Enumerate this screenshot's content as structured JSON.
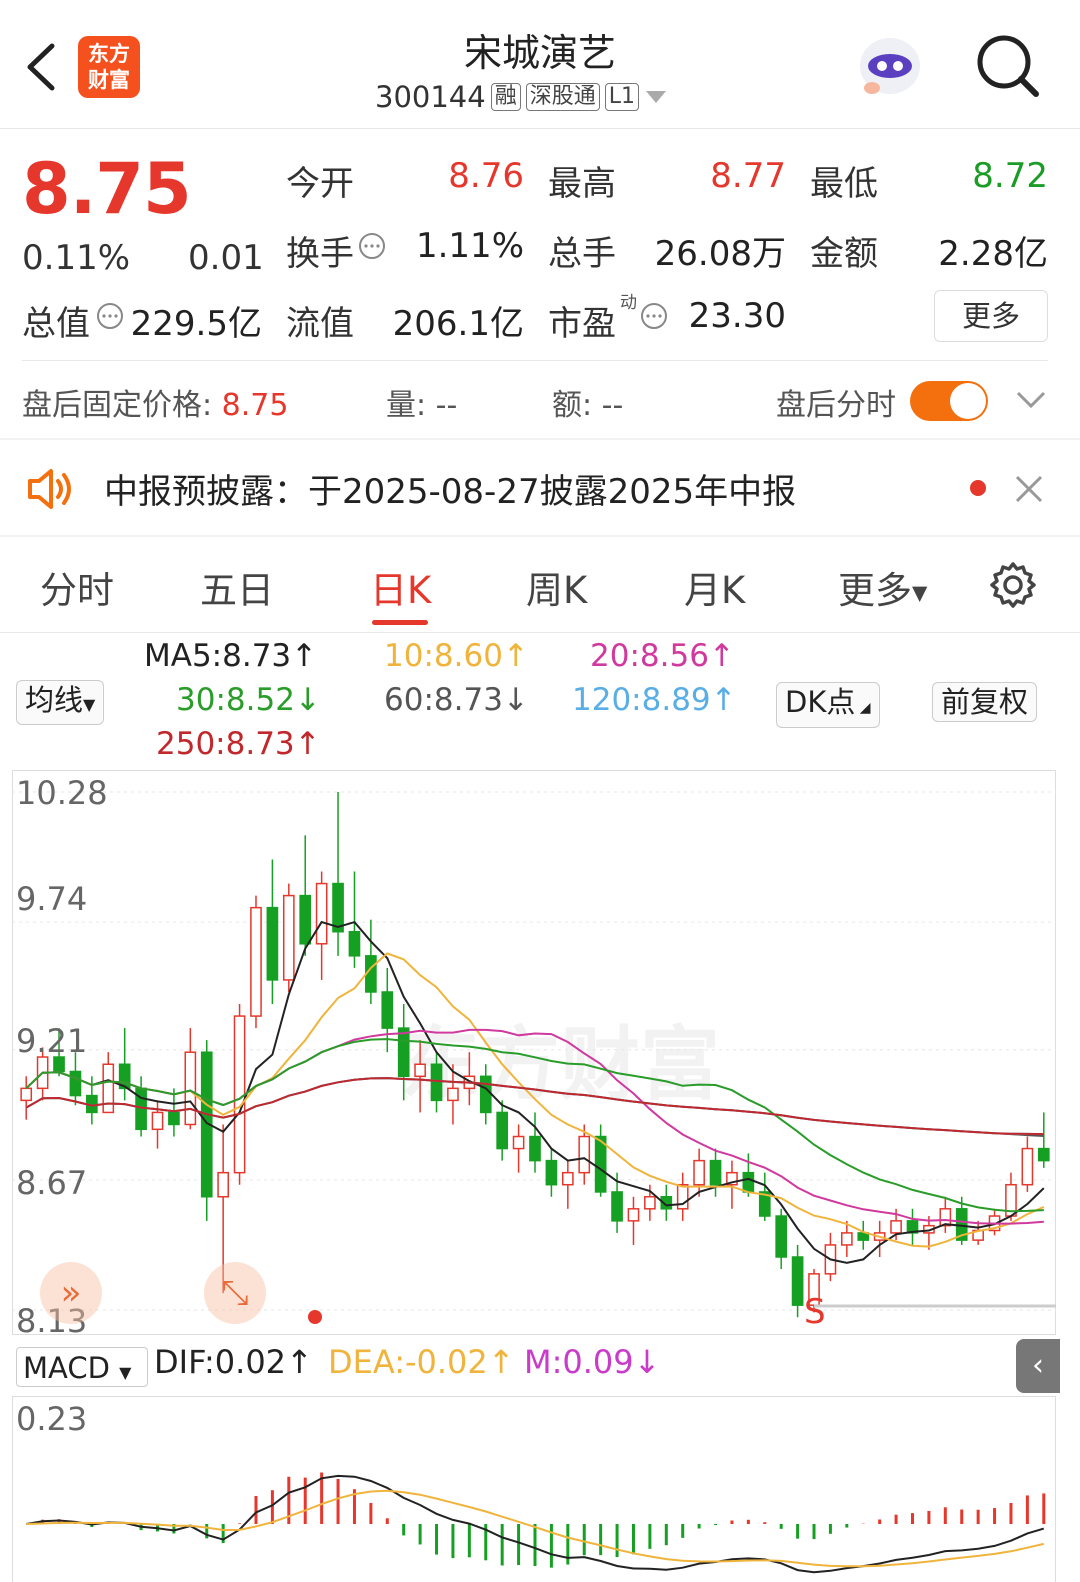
{
  "header": {
    "app_logo_text_line1": "东方",
    "app_logo_text_line2": "财富",
    "stock_name": "宋城演艺",
    "stock_code": "300144",
    "tags": [
      "融",
      "深股通",
      "L1"
    ]
  },
  "quote": {
    "price": "8.75",
    "change_pct": "0.11%",
    "change": "0.01",
    "fields": [
      {
        "label": "今开",
        "value": "8.76",
        "color": "red"
      },
      {
        "label": "最高",
        "value": "8.77",
        "color": "red"
      },
      {
        "label": "最低",
        "value": "8.72",
        "color": "green"
      },
      {
        "label": "换手",
        "value": "1.11%",
        "color": "normal"
      },
      {
        "label": "总手",
        "value": "26.08万",
        "color": "normal"
      },
      {
        "label": "金额",
        "value": "2.28亿",
        "color": "normal"
      },
      {
        "label": "总值",
        "value": "229.5亿",
        "color": "normal"
      },
      {
        "label": "流值",
        "value": "206.1亿",
        "color": "normal"
      },
      {
        "label": "市盈",
        "value": "23.30",
        "color": "normal",
        "superscript": "动"
      }
    ],
    "more_label": "更多"
  },
  "after_hours": {
    "fixed_price_label": "盘后固定价格:",
    "fixed_price_value": "8.75",
    "volume_label": "量:",
    "volume_value": "--",
    "amount_label": "额:",
    "amount_value": "--",
    "intraday_label": "盘后分时",
    "intraday_on": true
  },
  "notice": {
    "text": "中报预披露：于2025-08-27披露2025年中报"
  },
  "tabs": [
    {
      "label": "分时",
      "active": false
    },
    {
      "label": "五日",
      "active": false
    },
    {
      "label": "日K",
      "active": true
    },
    {
      "label": "周K",
      "active": false
    },
    {
      "label": "月K",
      "active": false
    },
    {
      "label": "更多",
      "active": false
    }
  ],
  "ma_legend": {
    "selector": "均线",
    "items": [
      {
        "text": "MA5:8.73↑",
        "color": "#222222"
      },
      {
        "text": "10:8.60↑",
        "color": "#f0b43c"
      },
      {
        "text": "20:8.56↑",
        "color": "#d0399e"
      },
      {
        "text": "30:8.52↓",
        "color": "#2a9c2a"
      },
      {
        "text": "60:8.73↓",
        "color": "#555555"
      },
      {
        "text": "120:8.89↑",
        "color": "#5aaee6"
      },
      {
        "text": "250:8.73↑",
        "color": "#c0282c"
      }
    ],
    "dk_button": "DK点",
    "adjust_button": "前复权"
  },
  "kline": {
    "y_labels": [
      "10.28",
      "9.74",
      "9.21",
      "8.67",
      "8.13"
    ],
    "signal_label": "S",
    "watermark": "东方财富"
  },
  "macd": {
    "selector": "MACD",
    "dif": "DIF:0.02↑",
    "dea": "DEA:-0.02↑",
    "m": "M:0.09↓",
    "y_label": "0.23"
  },
  "chart_data": {
    "type": "candlestick",
    "ylim": [
      8.13,
      10.28
    ],
    "y_ticks": [
      10.28,
      9.74,
      9.21,
      8.67,
      8.13
    ],
    "candles": [
      [
        9.0,
        9.1,
        8.92,
        9.05
      ],
      [
        9.05,
        9.22,
        9.0,
        9.18
      ],
      [
        9.18,
        9.3,
        9.1,
        9.12
      ],
      [
        9.12,
        9.2,
        8.98,
        9.02
      ],
      [
        9.02,
        9.1,
        8.9,
        8.95
      ],
      [
        8.95,
        9.2,
        8.95,
        9.15
      ],
      [
        9.15,
        9.3,
        9.0,
        9.05
      ],
      [
        9.05,
        9.1,
        8.85,
        8.88
      ],
      [
        8.88,
        9.0,
        8.8,
        8.95
      ],
      [
        8.95,
        9.05,
        8.85,
        8.9
      ],
      [
        8.9,
        9.3,
        8.88,
        9.2
      ],
      [
        9.2,
        9.25,
        8.5,
        8.6
      ],
      [
        8.6,
        8.9,
        8.2,
        8.7
      ],
      [
        8.7,
        9.4,
        8.65,
        9.35
      ],
      [
        9.35,
        9.85,
        9.3,
        9.8
      ],
      [
        9.8,
        10.0,
        9.4,
        9.5
      ],
      [
        9.5,
        9.9,
        9.45,
        9.85
      ],
      [
        9.85,
        10.1,
        9.6,
        9.65
      ],
      [
        9.65,
        9.95,
        9.5,
        9.9
      ],
      [
        9.9,
        10.28,
        9.6,
        9.7
      ],
      [
        9.7,
        9.95,
        9.55,
        9.6
      ],
      [
        9.6,
        9.75,
        9.4,
        9.45
      ],
      [
        9.45,
        9.55,
        9.2,
        9.3
      ],
      [
        9.3,
        9.4,
        9.0,
        9.1
      ],
      [
        9.1,
        9.25,
        8.95,
        9.15
      ],
      [
        9.15,
        9.2,
        8.95,
        9.0
      ],
      [
        9.0,
        9.15,
        8.9,
        9.05
      ],
      [
        9.05,
        9.2,
        8.98,
        9.1
      ],
      [
        9.1,
        9.15,
        8.9,
        8.95
      ],
      [
        8.95,
        9.0,
        8.75,
        8.8
      ],
      [
        8.8,
        8.9,
        8.7,
        8.85
      ],
      [
        8.85,
        8.95,
        8.7,
        8.75
      ],
      [
        8.75,
        8.8,
        8.6,
        8.65
      ],
      [
        8.65,
        8.75,
        8.55,
        8.7
      ],
      [
        8.7,
        8.9,
        8.65,
        8.85
      ],
      [
        8.85,
        8.9,
        8.6,
        8.62
      ],
      [
        8.62,
        8.7,
        8.45,
        8.5
      ],
      [
        8.5,
        8.6,
        8.4,
        8.55
      ],
      [
        8.55,
        8.65,
        8.5,
        8.6
      ],
      [
        8.6,
        8.65,
        8.5,
        8.55
      ],
      [
        8.55,
        8.7,
        8.5,
        8.65
      ],
      [
        8.65,
        8.8,
        8.6,
        8.75
      ],
      [
        8.75,
        8.8,
        8.6,
        8.65
      ],
      [
        8.65,
        8.75,
        8.55,
        8.7
      ],
      [
        8.7,
        8.78,
        8.6,
        8.62
      ],
      [
        8.62,
        8.7,
        8.5,
        8.52
      ],
      [
        8.52,
        8.55,
        8.3,
        8.35
      ],
      [
        8.35,
        8.4,
        8.1,
        8.15
      ],
      [
        8.15,
        8.3,
        8.12,
        8.28
      ],
      [
        8.28,
        8.45,
        8.25,
        8.4
      ],
      [
        8.4,
        8.5,
        8.35,
        8.45
      ],
      [
        8.45,
        8.5,
        8.38,
        8.42
      ],
      [
        8.42,
        8.5,
        8.35,
        8.45
      ],
      [
        8.45,
        8.55,
        8.42,
        8.5
      ],
      [
        8.5,
        8.55,
        8.4,
        8.45
      ],
      [
        8.45,
        8.52,
        8.38,
        8.48
      ],
      [
        8.48,
        8.6,
        8.45,
        8.55
      ],
      [
        8.55,
        8.6,
        8.4,
        8.42
      ],
      [
        8.42,
        8.5,
        8.4,
        8.46
      ],
      [
        8.46,
        8.55,
        8.44,
        8.52
      ],
      [
        8.52,
        8.7,
        8.5,
        8.65
      ],
      [
        8.65,
        8.85,
        8.62,
        8.8
      ],
      [
        8.8,
        8.95,
        8.72,
        8.75
      ]
    ],
    "ma_series": [
      {
        "name": "MA5",
        "color": "#222222"
      },
      {
        "name": "10",
        "color": "#f0b43c"
      },
      {
        "name": "20",
        "color": "#d0399e"
      },
      {
        "name": "30",
        "color": "#2a9c2a"
      },
      {
        "name": "60",
        "color": "#555555"
      },
      {
        "name": "120",
        "color": "#5aaee6"
      },
      {
        "name": "250",
        "color": "#c0282c"
      }
    ]
  }
}
